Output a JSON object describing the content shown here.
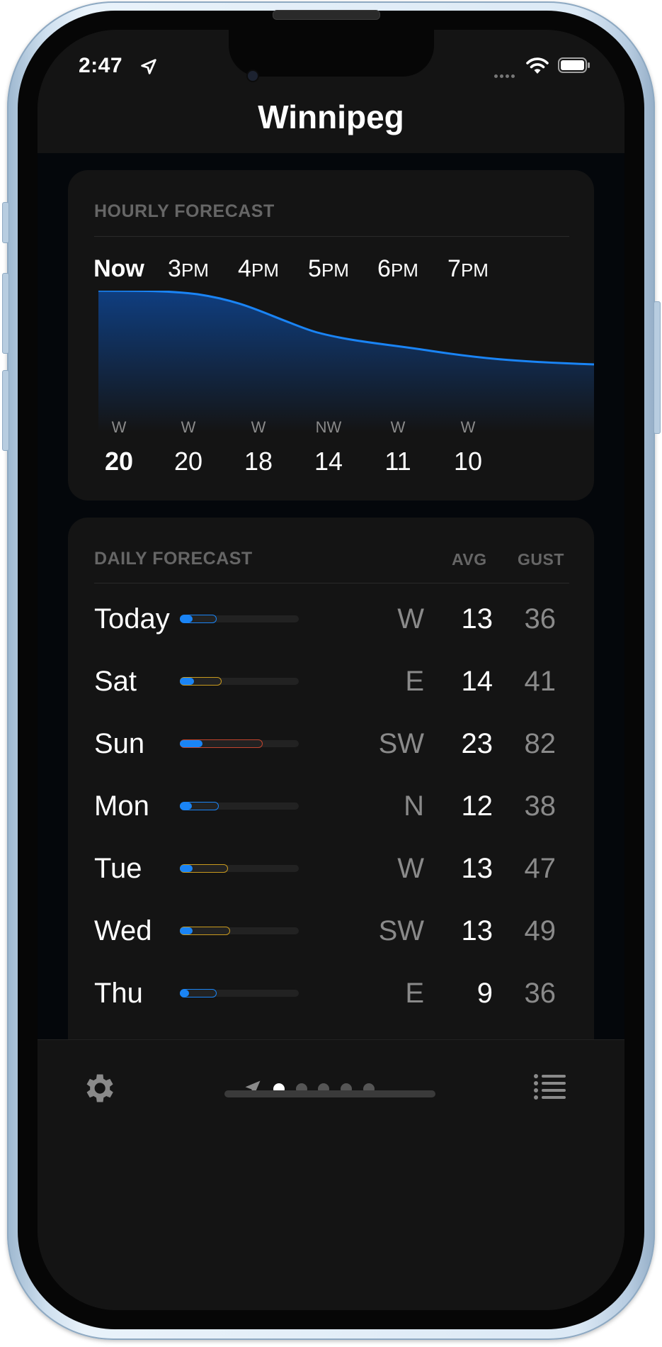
{
  "status_bar": {
    "time": "2:47"
  },
  "header": {
    "title": "Winnipeg"
  },
  "hourly": {
    "label": "HOURLY FORECAST",
    "hours": [
      {
        "num": "Now",
        "suffix": "",
        "dir": "W",
        "speed": "20"
      },
      {
        "num": "3",
        "suffix": "PM",
        "dir": "W",
        "speed": "20"
      },
      {
        "num": "4",
        "suffix": "PM",
        "dir": "W",
        "speed": "18"
      },
      {
        "num": "5",
        "suffix": "PM",
        "dir": "NW",
        "speed": "14"
      },
      {
        "num": "6",
        "suffix": "PM",
        "dir": "W",
        "speed": "11"
      },
      {
        "num": "7",
        "suffix": "PM",
        "dir": "W",
        "speed": "10"
      }
    ]
  },
  "daily": {
    "label": "DAILY FORECAST",
    "avg_header": "AVG",
    "gust_header": "GUST",
    "days": [
      {
        "name": "Today",
        "dir": "W",
        "avg": "13",
        "gust": "36",
        "gust_color": "#1a84f5"
      },
      {
        "name": "Sat",
        "dir": "E",
        "avg": "14",
        "gust": "41",
        "gust_color": "#c99a1e"
      },
      {
        "name": "Sun",
        "dir": "SW",
        "avg": "23",
        "gust": "82",
        "gust_color": "#c2442d"
      },
      {
        "name": "Mon",
        "dir": "N",
        "avg": "12",
        "gust": "38",
        "gust_color": "#1a84f5"
      },
      {
        "name": "Tue",
        "dir": "W",
        "avg": "13",
        "gust": "47",
        "gust_color": "#c99a1e"
      },
      {
        "name": "Wed",
        "dir": "SW",
        "avg": "13",
        "gust": "49",
        "gust_color": "#c99a1e"
      },
      {
        "name": "Thu",
        "dir": "E",
        "avg": "9",
        "gust": "36",
        "gust_color": "#1a84f5"
      }
    ]
  },
  "pager": {
    "page_count": 5,
    "active_index": 0
  },
  "icons": {
    "settings": "gear-icon",
    "location": "location-arrow-icon",
    "list": "list-icon"
  },
  "colors": {
    "accent": "#1a84f5",
    "background": "#141414",
    "text_primary": "#ffffff",
    "text_secondary": "#8a8a8a"
  }
}
